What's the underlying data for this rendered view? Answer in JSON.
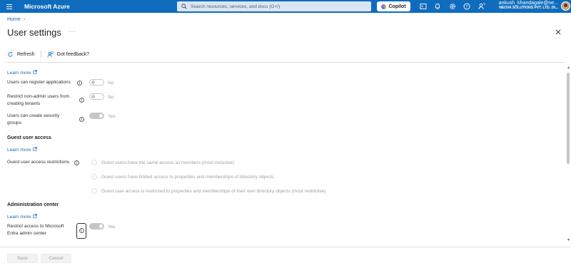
{
  "topbar": {
    "brand": "Microsoft Azure",
    "search_placeholder": "Search resources, services, and docs (G+/)",
    "copilot_label": "Copilot",
    "account_user": "ankush_khandagale@ne...",
    "account_org": "NEOVA SOLUTIONS PVT. LTD. (N...",
    "accent": "#0f6cbd"
  },
  "breadcrumb": {
    "home": "Home"
  },
  "page": {
    "title": "User settings",
    "more": "···"
  },
  "commands": {
    "refresh": "Refresh",
    "feedback": "Got feedback?"
  },
  "settings": {
    "learn_more_1": "Learn more",
    "register_apps": {
      "label": "Users can register applications",
      "value": "No",
      "on": false
    },
    "restrict_nonadmin": {
      "label_line1": "Restrict non-admin users from",
      "label_line2": "creating tenants",
      "value": "No",
      "on": false
    },
    "security_groups": {
      "label_line1": "Users can create security",
      "label_line2": "groups",
      "value": "Yes",
      "on": true
    }
  },
  "guest": {
    "heading": "Guest user access",
    "learn_more": "Learn more",
    "label": "Guest user access restrictions",
    "options": [
      {
        "label": "Guest users have the same access as members (most inclusive)",
        "selected": false
      },
      {
        "label": "Guest users have limited access to properties and memberships of directory objects",
        "selected": true
      },
      {
        "label": "Guest user access is restricted to properties and memberships of their own directory objects (most restrictive)",
        "selected": false
      }
    ]
  },
  "admin": {
    "heading": "Administration center",
    "learn_more": "Learn more",
    "label_line1": "Restrict access to Microsoft",
    "label_line2": "Entra admin center",
    "value": "Yes",
    "on": true
  },
  "footer": {
    "save": "Save",
    "cancel": "Cancel"
  }
}
